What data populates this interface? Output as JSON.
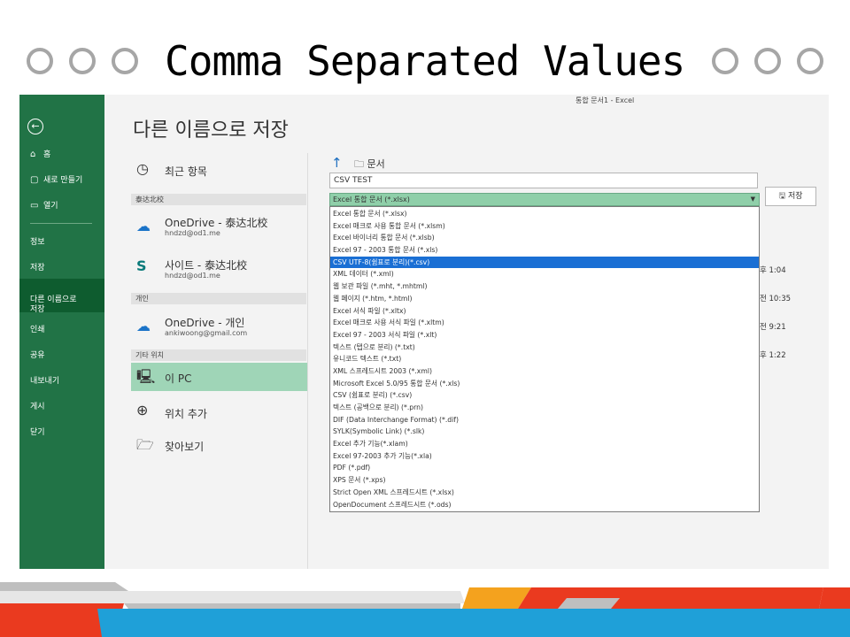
{
  "slide": {
    "title": "Comma Separated Values"
  },
  "window_title": "통합 문서1 - Excel",
  "sidebar": {
    "items": [
      {
        "label": "홈",
        "icon": "home-icon"
      },
      {
        "label": "새로 만들기",
        "icon": "new-doc-icon"
      },
      {
        "label": "열기",
        "icon": "folder-icon"
      },
      {
        "label": "정보"
      },
      {
        "label": "저장"
      },
      {
        "label": "다른 이름으로\n저장"
      },
      {
        "label": "인쇄"
      },
      {
        "label": "공유"
      },
      {
        "label": "내보내기"
      },
      {
        "label": "게시"
      },
      {
        "label": "닫기"
      }
    ]
  },
  "page_heading": "다른 이름으로 저장",
  "locations": {
    "recent": "최근 항목",
    "section_org": "泰达北校",
    "onedrive_org": {
      "name": "OneDrive - 泰达北校",
      "sub": "hndzd@od1.me"
    },
    "site_org": {
      "name": "사이트 - 泰达北校",
      "sub": "hndzd@od1.me"
    },
    "section_personal": "개인",
    "onedrive_personal": {
      "name": "OneDrive - 개인",
      "sub": "ankiwoong@gmail.com"
    },
    "section_other": "기타 위치",
    "this_pc": "이 PC",
    "add_place": "위치 추가",
    "browse": "찾아보기"
  },
  "path": {
    "folder": "문서"
  },
  "filename": "CSV TEST",
  "filetype_selected": "Excel 통합 문서 (*.xlsx)",
  "save_label": "저장",
  "filetype_options": [
    "Excel 통합 문서 (*.xlsx)",
    "Excel 매크로 사용 통합 문서 (*.xlsm)",
    "Excel 바이너리 통합 문서 (*.xlsb)",
    "Excel 97 - 2003 통합 문서 (*.xls)",
    "CSV UTF-8(쉼표로 분리)(*.csv)",
    "XML 데이터 (*.xml)",
    "웹 보관 파일 (*.mht, *.mhtml)",
    "웹 페이지 (*.htm, *.html)",
    "Excel 서식 파일 (*.xltx)",
    "Excel 매크로 사용 서식 파일 (*.xltm)",
    "Excel 97 - 2003 서식 파일 (*.xlt)",
    "텍스트 (탭으로 분리) (*.txt)",
    "유니코드 텍스트 (*.txt)",
    "XML 스프레드시트 2003 (*.xml)",
    "Microsoft Excel 5.0/95 통합 문서 (*.xls)",
    "CSV (쉼표로 분리) (*.csv)",
    "텍스트 (공백으로 분리) (*.prn)",
    "DIF (Data Interchange Format) (*.dif)",
    "SYLK(Symbolic Link) (*.slk)",
    "Excel 추가 기능(*.xlam)",
    "Excel 97-2003 추가 기능(*.xla)",
    "PDF (*.pdf)",
    "XPS 문서 (*.xps)",
    "Strict Open XML 스프레드시트 (*.xlsx)",
    "OpenDocument 스프레드시트 (*.ods)"
  ],
  "selected_option_index": 4,
  "partial_times": [
    "후 1:04",
    "전 10:35",
    "전 9:21",
    "후 1:22"
  ],
  "colors": {
    "excel_green": "#217346",
    "selection_blue": "#1a6fd4",
    "pc_highlight": "#9fd5b7"
  }
}
